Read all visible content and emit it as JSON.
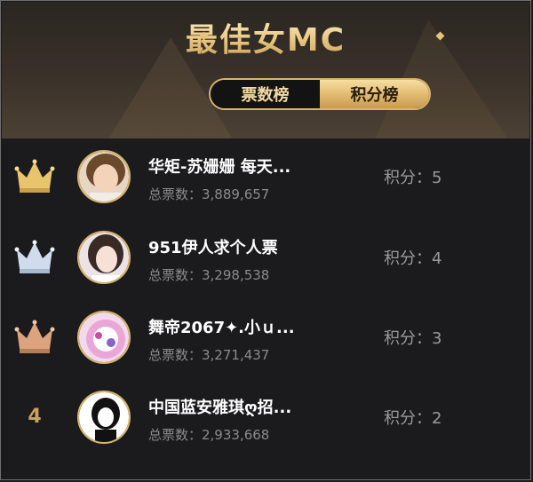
{
  "header": {
    "title": "最佳女MC",
    "tabs": [
      {
        "label": "票数榜",
        "active": false
      },
      {
        "label": "积分榜",
        "active": true
      }
    ]
  },
  "colors": {
    "gold": "#e2bc72",
    "silver": "#c9d7e6",
    "bronze": "#d9a07a",
    "background": "#1b1b1d"
  },
  "ranking": [
    {
      "rank": "1",
      "rank_icon": "gold-crown-icon",
      "name": "华矩-苏姗姗 每天...",
      "votes": "总票数：3,889,657",
      "score": "积分：5"
    },
    {
      "rank": "2",
      "rank_icon": "silver-crown-icon",
      "name": "951伊人求个人票",
      "votes": "总票数：3,298,538",
      "score": "积分：4"
    },
    {
      "rank": "3",
      "rank_icon": "bronze-crown-icon",
      "name": "舞帝2067✦.小ｕ...",
      "votes": "总票数：3,271,437",
      "score": "积分：3"
    },
    {
      "rank": "4",
      "rank_icon": "",
      "name": "中国蓝安雅琪ღ招...",
      "votes": "总票数：2,933,668",
      "score": "积分：2"
    }
  ]
}
